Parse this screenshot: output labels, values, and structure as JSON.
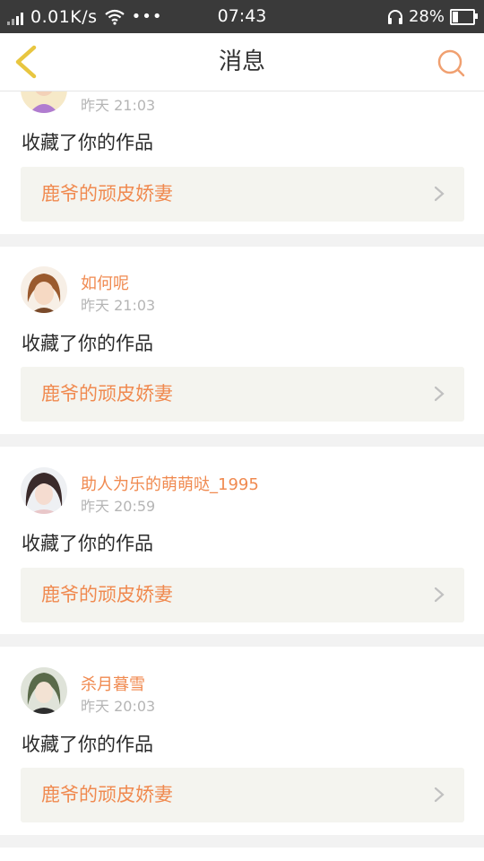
{
  "status_bar": {
    "net_speed": "0.01K/s",
    "dots": "•••",
    "time": "07:43",
    "battery_percent": "28%",
    "battery_level": 0.28,
    "icons": [
      "signal-icon",
      "wifi-icon",
      "headphones-icon",
      "battery-icon"
    ]
  },
  "header": {
    "title": "消息",
    "back_icon": "chevron-left-icon",
    "search_icon": "search-icon",
    "accent": "#f0a070"
  },
  "messages": [
    {
      "username": "",
      "time": "昨天 21:03",
      "action": "收藏了你的作品",
      "work_title": "鹿爷的顽皮娇妻"
    },
    {
      "username": "如何呢",
      "time": "昨天 21:03",
      "action": "收藏了你的作品",
      "work_title": "鹿爷的顽皮娇妻"
    },
    {
      "username": "助人为乐的萌萌哒_1995",
      "time": "昨天 20:59",
      "action": "收藏了你的作品",
      "work_title": "鹿爷的顽皮娇妻"
    },
    {
      "username": "杀月暮雪",
      "time": "昨天 20:03",
      "action": "收藏了你的作品",
      "work_title": "鹿爷的顽皮娇妻"
    }
  ],
  "colors": {
    "status_bar_bg": "#3a3a3a",
    "name_color": "#f08a50",
    "time_color": "#b5b5b5",
    "page_bg": "#f2f2f2",
    "work_bg": "#f4f4ef"
  }
}
